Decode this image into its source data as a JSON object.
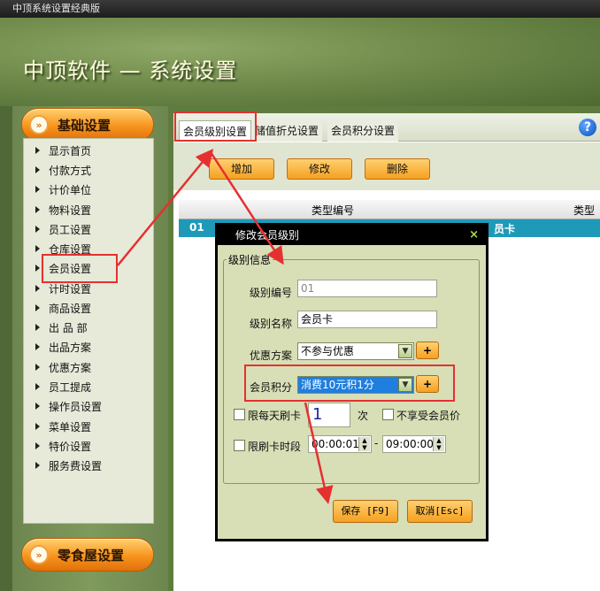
{
  "window": {
    "title": "中顶系统设置经典版"
  },
  "header": {
    "title": "中顶软件 — 系统设置"
  },
  "sidebar": {
    "basic_header": "基础设置",
    "snack_header": "零食屋设置",
    "items": [
      "显示首页",
      "付款方式",
      "计价单位",
      "物料设置",
      "员工设置",
      "仓库设置",
      "会员设置",
      "计时设置",
      "商品设置",
      "出 品 部",
      "出品方案",
      "优惠方案",
      "员工提成",
      "操作员设置",
      "菜单设置",
      "特价设置",
      "服务费设置"
    ]
  },
  "tabs": [
    "会员级别设置",
    "储值折兑设置",
    "会员积分设置"
  ],
  "toolbar": {
    "add": "增加",
    "edit": "修改",
    "delete": "删除"
  },
  "grid": {
    "columns": [
      "类型编号",
      "类型名"
    ],
    "row": {
      "code": "01",
      "name": "员卡"
    }
  },
  "dialog": {
    "title": "修改会员级别",
    "group_title": "级别信息",
    "level_code_label": "级别编号",
    "level_code_value": "01",
    "level_name_label": "级别名称",
    "level_name_value": "会员卡",
    "discount_label": "优惠方案",
    "discount_value": "不参与优惠",
    "points_label": "会员积分",
    "points_value": "消费10元积1分",
    "plus_label": "+",
    "daily_limit_label": "限每天刷卡",
    "daily_limit_value": "1",
    "daily_limit_unit": "次",
    "no_member_price_label": "不享受会员价",
    "time_limit_label": "限刷卡时段",
    "time_start": "00:00:01",
    "time_separator": "-",
    "time_end": "09:00:00",
    "save": "保存 [F9]",
    "cancel": "取消[Esc]"
  }
}
